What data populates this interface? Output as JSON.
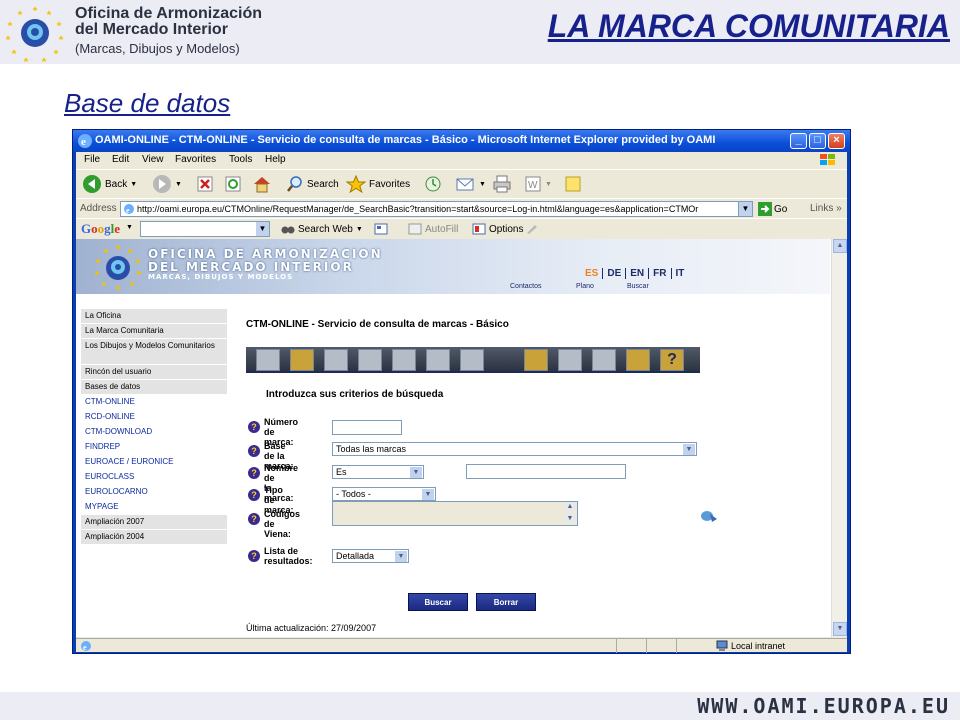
{
  "slide": {
    "org_line1": "Oficina de Armonización",
    "org_line2": "del Mercado Interior",
    "org_line3": "(Marcas, Dibujos y Modelos)",
    "title": "LA MARCA COMUNITARIA",
    "section_title": "Base de datos",
    "footer_url": "WWW.OAMI.EUROPA.EU"
  },
  "browser": {
    "window_title": "OAMI-ONLINE - CTM-ONLINE - Servicio de consulta de marcas - Básico - Microsoft Internet Explorer provided by OAMI",
    "menu": [
      "File",
      "Edit",
      "View",
      "Favorites",
      "Tools",
      "Help"
    ],
    "toolbar": {
      "back": "Back",
      "search": "Search",
      "favorites": "Favorites"
    },
    "address_label": "Address",
    "address_url": "http://oami.europa.eu/CTMOnline/RequestManager/de_SearchBasic?transition=start&source=Log-in.html&language=es&application=CTMOr",
    "go": "Go",
    "links": "Links",
    "google": {
      "logo": "Google",
      "search_web": "Search Web",
      "autofill": "AutoFill",
      "options": "Options"
    },
    "status_zone": "Local intranet"
  },
  "site": {
    "banner_line1": "OFICINA DE ARMONIZACION",
    "banner_line2": "DEL MERCADO INTERIOR",
    "banner_line3": "MARCAS, DIBUJOS Y MODELOS",
    "languages": [
      {
        "code": "ES",
        "active": true
      },
      {
        "code": "DE",
        "active": false
      },
      {
        "code": "EN",
        "active": false
      },
      {
        "code": "FR",
        "active": false
      },
      {
        "code": "IT",
        "active": false
      }
    ],
    "top_links": [
      "Contactos",
      "Plano",
      "Buscar"
    ],
    "nav": [
      {
        "label": "La Oficina",
        "type": "main"
      },
      {
        "label": "La Marca Comunitaria",
        "type": "main"
      },
      {
        "label": "Los Dibujos y Modelos Comunitarios",
        "type": "main-tall"
      },
      {
        "label": "Rincón del usuario",
        "type": "main"
      },
      {
        "label": "Bases de datos",
        "type": "main"
      },
      {
        "label": "CTM-ONLINE",
        "type": "sub"
      },
      {
        "label": "RCD-ONLINE",
        "type": "sub"
      },
      {
        "label": "CTM-DOWNLOAD",
        "type": "sub"
      },
      {
        "label": "FINDREP",
        "type": "sub"
      },
      {
        "label": "EUROACE / EURONICE",
        "type": "sub"
      },
      {
        "label": "EUROCLASS",
        "type": "sub"
      },
      {
        "label": "EUROLOCARNO",
        "type": "sub"
      },
      {
        "label": "MYPAGE",
        "type": "sub"
      },
      {
        "label": "Ampliación 2007",
        "type": "main"
      },
      {
        "label": "Ampliación 2004",
        "type": "main"
      }
    ],
    "page_heading": "CTM-ONLINE - Servicio de consulta de marcas - Básico",
    "search_heading": "Introduzca sus criterios de búsqueda",
    "form": {
      "numero_label": "Número de\nmarca:",
      "numero_value": "",
      "base_label": " Base de la\nmarca:",
      "base_value": "Todas las marcas",
      "nombre_label": "Nombre de\nla marca:",
      "nombre_operator": "Es",
      "nombre_value": "",
      "tipo_label": "Tipo de\nmarca:",
      "tipo_value": "- Todos -",
      "viena_label": "Códigos de\nViena:",
      "lista_label": "Lista de\nresultados:",
      "lista_value": "Detallada"
    },
    "buscar": "Buscar",
    "borrar": "Borrar",
    "last_update": "Última actualización: 27/09/2007"
  }
}
